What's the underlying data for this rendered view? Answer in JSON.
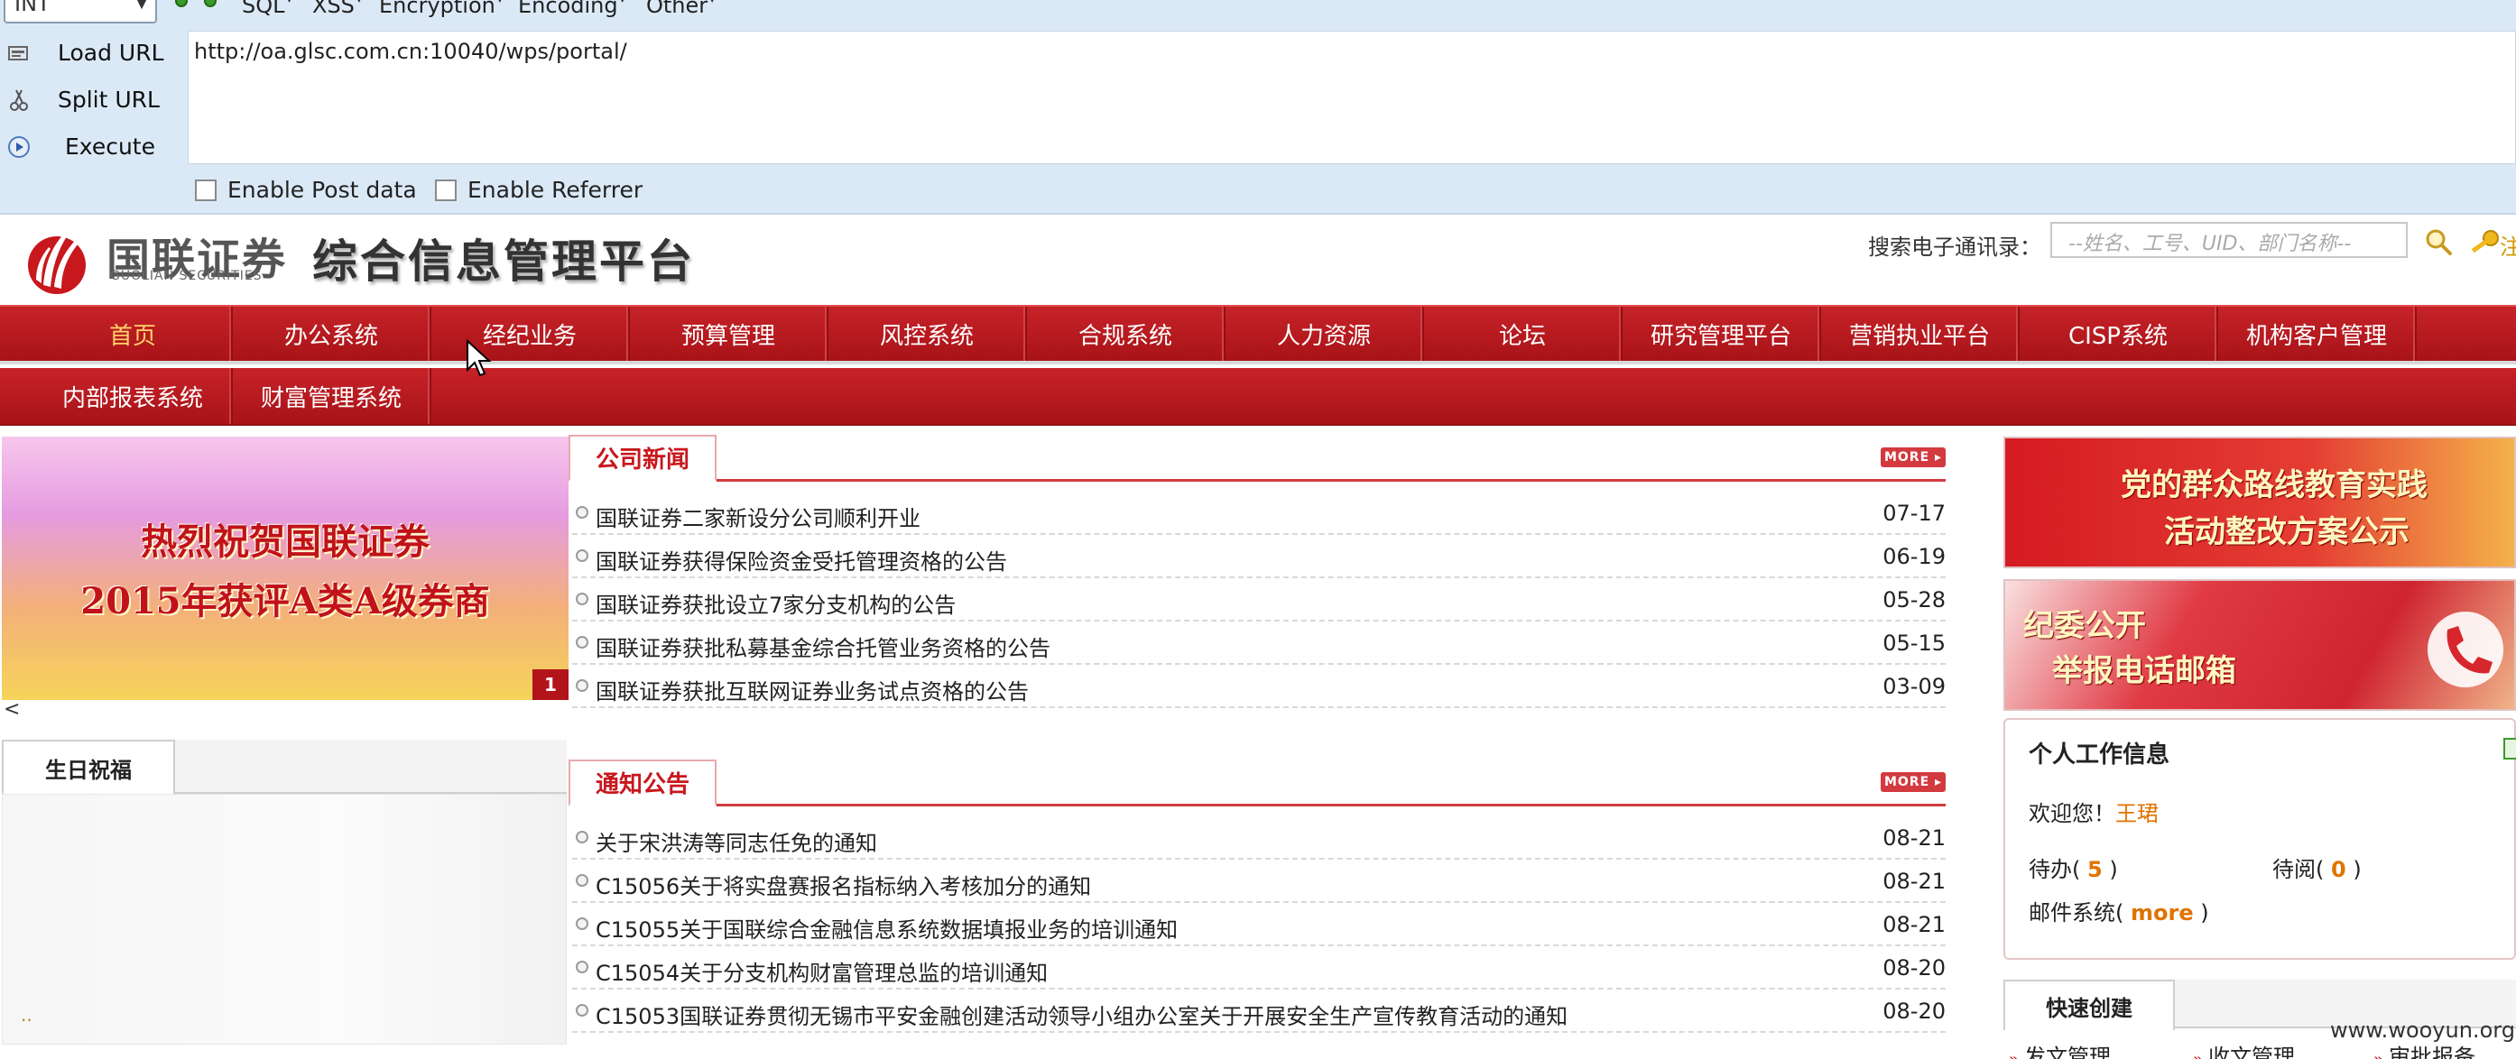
{
  "hackbar": {
    "type_select": "INT",
    "menu": [
      "SQL",
      "XSS",
      "Encryption",
      "Encoding",
      "Other"
    ],
    "buttons": {
      "load": "Load URL",
      "split": "Split URL",
      "execute": "Execute"
    },
    "url": "http://oa.glsc.com.cn:10040/wps/portal/",
    "enable_post": "Enable Post data",
    "enable_referrer": "Enable Referrer"
  },
  "header": {
    "logo_cn": "国联证券",
    "logo_en": "GUOLIAN SECURITIES",
    "platform_title": "综合信息管理平台",
    "search_label": "搜索电子通讯录：",
    "search_placeholder": "--姓名、工号、UID、部门名称--",
    "key_text": "注"
  },
  "nav": {
    "row1": [
      "首页",
      "办公系统",
      "经纪业务",
      "预算管理",
      "风控系统",
      "合规系统",
      "人力资源",
      "论坛",
      "研究管理平台",
      "营销执业平台",
      "CISP系统",
      "机构客户管理"
    ],
    "row2": [
      "内部报表系统",
      "财富管理系统"
    ]
  },
  "banner": {
    "line1": "热烈祝贺国联证券",
    "line2": "2015年获评A类A级券商",
    "badge": "1",
    "prev": "<"
  },
  "birthday": {
    "tab": "生日祝福",
    "dots": ".."
  },
  "company_news": {
    "title": "公司新闻",
    "more": "MORE ▸",
    "items": [
      {
        "title": "国联证券二家新设分公司顺利开业",
        "date": "07-17"
      },
      {
        "title": "国联证券获得保险资金受托管理资格的公告",
        "date": "06-19"
      },
      {
        "title": "国联证券获批设立7家分支机构的公告",
        "date": "05-28"
      },
      {
        "title": "国联证券获批私募基金综合托管业务资格的公告",
        "date": "05-15"
      },
      {
        "title": "国联证券获批互联网证券业务试点资格的公告",
        "date": "03-09"
      }
    ]
  },
  "notices": {
    "title": "通知公告",
    "more": "MORE ▸",
    "items": [
      {
        "title": "关于宋洪涛等同志任免的通知",
        "date": "08-21"
      },
      {
        "title": "C15056关于将实盘赛报名指标纳入考核加分的通知",
        "date": "08-21"
      },
      {
        "title": "C15055关于国联综合金融信息系统数据填报业务的培训通知",
        "date": "08-21"
      },
      {
        "title": "C15054关于分支机构财富管理总监的培训通知",
        "date": "08-20"
      },
      {
        "title": "C15053国联证券贯彻无锡市平安金融创建活动领导小组办公室关于开展安全生产宣传教育活动的通知",
        "date": "08-20"
      }
    ]
  },
  "promos": {
    "p1_line1": "党的群众路线教育实践",
    "p1_line2": "活动整改方案公示",
    "p2_line1": "纪委公开",
    "p2_line2": "举报电话邮箱"
  },
  "work": {
    "title": "个人工作信息",
    "welcome": "欢迎您！",
    "name": "王珺",
    "todo_label": "待办(",
    "todo_count": "5",
    "toread_label": "待阅(",
    "toread_count": "0",
    "close": ")",
    "mail_label": "邮件系统(",
    "mail_more": "more"
  },
  "quick": {
    "tab": "快速创建",
    "links": [
      "发文管理",
      "收文管理",
      "审批报备"
    ]
  },
  "watermark": "www.wooyun.org"
}
